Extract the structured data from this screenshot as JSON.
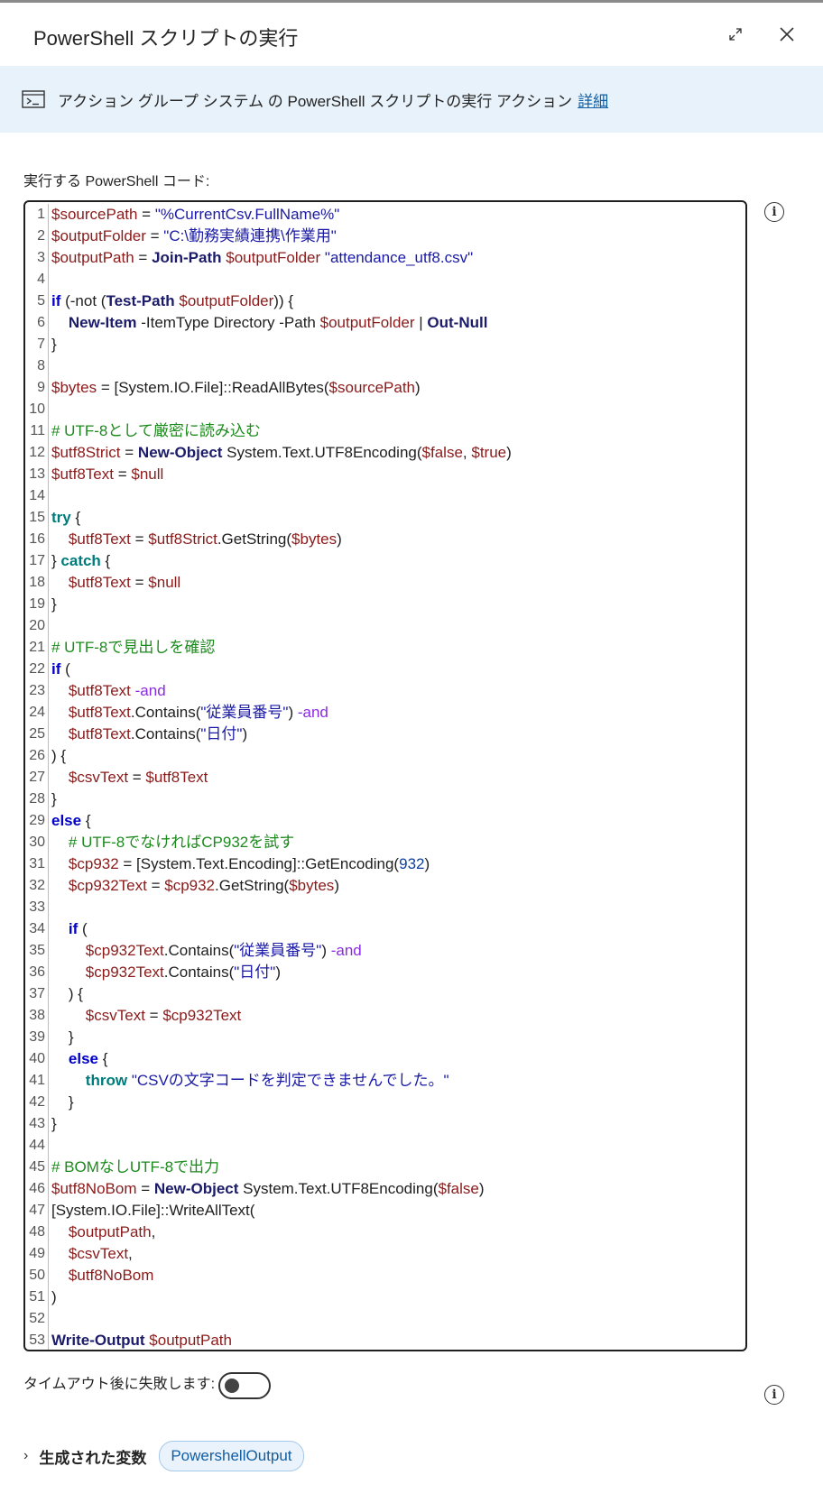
{
  "dialog": {
    "title": "PowerShell スクリプトの実行",
    "expand_label": "⤢",
    "close_label": "✕"
  },
  "banner": {
    "text": "アクション グループ システム の PowerShell スクリプトの実行 アクション",
    "link": "詳細"
  },
  "code_field": {
    "label": "実行する PowerShell コード:",
    "line_numbers": [
      "1",
      "2",
      "3",
      "4",
      "5",
      "6",
      "7",
      "8",
      "9",
      "10",
      "11",
      "12",
      "13",
      "14",
      "15",
      "16",
      "17",
      "18",
      "19",
      "20",
      "21",
      "22",
      "23",
      "24",
      "25",
      "26",
      "27",
      "28",
      "29",
      "30",
      "31",
      "32",
      "33",
      "34",
      "35",
      "36",
      "37",
      "38",
      "39",
      "40",
      "41",
      "42",
      "43",
      "44",
      "45",
      "46",
      "47",
      "48",
      "49",
      "50",
      "51",
      "52",
      "53"
    ],
    "lines": [
      [
        [
          "v",
          "$sourcePath"
        ],
        [
          "p",
          " = "
        ],
        [
          "s",
          "\"%CurrentCsv.FullName%\""
        ]
      ],
      [
        [
          "v",
          "$outputFolder"
        ],
        [
          "p",
          " = "
        ],
        [
          "s",
          "\"C:\\勤務実績連携\\作業用\""
        ]
      ],
      [
        [
          "v",
          "$outputPath"
        ],
        [
          "p",
          " = "
        ],
        [
          "cmd",
          "Join-Path"
        ],
        [
          "p",
          " "
        ],
        [
          "v",
          "$outputFolder"
        ],
        [
          "p",
          " "
        ],
        [
          "s",
          "\"attendance_utf8.csv\""
        ]
      ],
      [],
      [
        [
          "k",
          "if"
        ],
        [
          "p",
          " (-not ("
        ],
        [
          "cmd",
          "Test-Path"
        ],
        [
          "p",
          " "
        ],
        [
          "v",
          "$outputFolder"
        ],
        [
          "p",
          ")) {"
        ]
      ],
      [
        [
          "p",
          "    "
        ],
        [
          "cmd",
          "New-Item"
        ],
        [
          "p",
          " -ItemType Directory -Path "
        ],
        [
          "v",
          "$outputFolder"
        ],
        [
          "p",
          " | "
        ],
        [
          "cmd",
          "Out-Null"
        ]
      ],
      [
        [
          "p",
          "}"
        ]
      ],
      [],
      [
        [
          "v",
          "$bytes"
        ],
        [
          "p",
          " = [System.IO.File]::ReadAllBytes("
        ],
        [
          "v",
          "$sourcePath"
        ],
        [
          "p",
          ")"
        ]
      ],
      [],
      [
        [
          "cm",
          "# UTF-8として厳密に読み込む"
        ]
      ],
      [
        [
          "v",
          "$utf8Strict"
        ],
        [
          "p",
          " = "
        ],
        [
          "cmd",
          "New-Object"
        ],
        [
          "p",
          " System.Text.UTF8Encoding("
        ],
        [
          "v",
          "$false"
        ],
        [
          "p",
          ", "
        ],
        [
          "v",
          "$true"
        ],
        [
          "p",
          ")"
        ]
      ],
      [
        [
          "v",
          "$utf8Text"
        ],
        [
          "p",
          " = "
        ],
        [
          "v",
          "$null"
        ]
      ],
      [],
      [
        [
          "kt",
          "try"
        ],
        [
          "p",
          " {"
        ]
      ],
      [
        [
          "p",
          "    "
        ],
        [
          "v",
          "$utf8Text"
        ],
        [
          "p",
          " = "
        ],
        [
          "v",
          "$utf8Strict"
        ],
        [
          "p",
          ".GetString("
        ],
        [
          "v",
          "$bytes"
        ],
        [
          "p",
          ")"
        ]
      ],
      [
        [
          "p",
          "} "
        ],
        [
          "kt",
          "catch"
        ],
        [
          "p",
          " {"
        ]
      ],
      [
        [
          "p",
          "    "
        ],
        [
          "v",
          "$utf8Text"
        ],
        [
          "p",
          " = "
        ],
        [
          "v",
          "$null"
        ]
      ],
      [
        [
          "p",
          "}"
        ]
      ],
      [],
      [
        [
          "cm",
          "# UTF-8で見出しを確認"
        ]
      ],
      [
        [
          "k",
          "if"
        ],
        [
          "p",
          " ("
        ]
      ],
      [
        [
          "p",
          "    "
        ],
        [
          "v",
          "$utf8Text"
        ],
        [
          "p",
          " "
        ],
        [
          "op",
          "-and"
        ]
      ],
      [
        [
          "p",
          "    "
        ],
        [
          "v",
          "$utf8Text"
        ],
        [
          "p",
          ".Contains("
        ],
        [
          "s",
          "\"従業員番号\""
        ],
        [
          "p",
          ") "
        ],
        [
          "op",
          "-and"
        ]
      ],
      [
        [
          "p",
          "    "
        ],
        [
          "v",
          "$utf8Text"
        ],
        [
          "p",
          ".Contains("
        ],
        [
          "s",
          "\"日付\""
        ],
        [
          "p",
          ")"
        ]
      ],
      [
        [
          "p",
          ") {"
        ]
      ],
      [
        [
          "p",
          "    "
        ],
        [
          "v",
          "$csvText"
        ],
        [
          "p",
          " = "
        ],
        [
          "v",
          "$utf8Text"
        ]
      ],
      [
        [
          "p",
          "}"
        ]
      ],
      [
        [
          "k",
          "else"
        ],
        [
          "p",
          " {"
        ]
      ],
      [
        [
          "p",
          "    "
        ],
        [
          "cm",
          "# UTF-8でなければCP932を試す"
        ]
      ],
      [
        [
          "p",
          "    "
        ],
        [
          "v",
          "$cp932"
        ],
        [
          "p",
          " = [System.Text.Encoding]::GetEncoding("
        ],
        [
          "num",
          "932"
        ],
        [
          "p",
          ")"
        ]
      ],
      [
        [
          "p",
          "    "
        ],
        [
          "v",
          "$cp932Text"
        ],
        [
          "p",
          " = "
        ],
        [
          "v",
          "$cp932"
        ],
        [
          "p",
          ".GetString("
        ],
        [
          "v",
          "$bytes"
        ],
        [
          "p",
          ")"
        ]
      ],
      [],
      [
        [
          "p",
          "    "
        ],
        [
          "k",
          "if"
        ],
        [
          "p",
          " ("
        ]
      ],
      [
        [
          "p",
          "        "
        ],
        [
          "v",
          "$cp932Text"
        ],
        [
          "p",
          ".Contains("
        ],
        [
          "s",
          "\"従業員番号\""
        ],
        [
          "p",
          ") "
        ],
        [
          "op",
          "-and"
        ]
      ],
      [
        [
          "p",
          "        "
        ],
        [
          "v",
          "$cp932Text"
        ],
        [
          "p",
          ".Contains("
        ],
        [
          "s",
          "\"日付\""
        ],
        [
          "p",
          ")"
        ]
      ],
      [
        [
          "p",
          "    ) {"
        ]
      ],
      [
        [
          "p",
          "        "
        ],
        [
          "v",
          "$csvText"
        ],
        [
          "p",
          " = "
        ],
        [
          "v",
          "$cp932Text"
        ]
      ],
      [
        [
          "p",
          "    }"
        ]
      ],
      [
        [
          "p",
          "    "
        ],
        [
          "k",
          "else"
        ],
        [
          "p",
          " {"
        ]
      ],
      [
        [
          "p",
          "        "
        ],
        [
          "kt",
          "throw"
        ],
        [
          "p",
          " "
        ],
        [
          "s",
          "\"CSVの文字コードを判定できませんでした。\""
        ]
      ],
      [
        [
          "p",
          "    }"
        ]
      ],
      [
        [
          "p",
          "}"
        ]
      ],
      [],
      [
        [
          "cm",
          "# BOMなしUTF-8で出力"
        ]
      ],
      [
        [
          "v",
          "$utf8NoBom"
        ],
        [
          "p",
          " = "
        ],
        [
          "cmd",
          "New-Object"
        ],
        [
          "p",
          " System.Text.UTF8Encoding("
        ],
        [
          "v",
          "$false"
        ],
        [
          "p",
          ")"
        ]
      ],
      [
        [
          "p",
          "[System.IO.File]::WriteAllText("
        ]
      ],
      [
        [
          "p",
          "    "
        ],
        [
          "v",
          "$outputPath"
        ],
        [
          "p",
          ","
        ]
      ],
      [
        [
          "p",
          "    "
        ],
        [
          "v",
          "$csvText"
        ],
        [
          "p",
          ","
        ]
      ],
      [
        [
          "p",
          "    "
        ],
        [
          "v",
          "$utf8NoBom"
        ]
      ],
      [
        [
          "p",
          ")"
        ]
      ],
      [],
      [
        [
          "cmd",
          "Write-Output"
        ],
        [
          "p",
          " "
        ],
        [
          "v",
          "$outputPath"
        ]
      ]
    ]
  },
  "timeout": {
    "label": "タイムアウト後に失敗します:",
    "enabled": false
  },
  "variables": {
    "label": "生成された変数",
    "chip": "PowershellOutput"
  },
  "colors": {
    "banner_bg": "#e8f2fb",
    "link": "#115ea3",
    "variable": "#8b1a1a",
    "string": "#1a1aa6",
    "keyword": "#0000c8",
    "comment": "#1d8a1d"
  }
}
